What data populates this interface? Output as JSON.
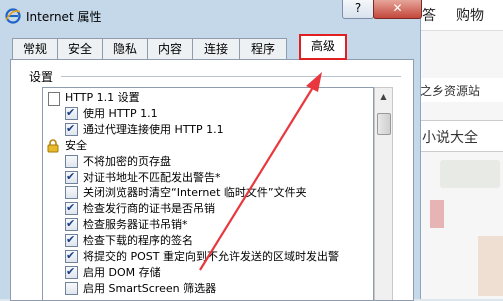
{
  "window": {
    "title": "Internet 属性",
    "help_label": "?",
    "close_label": "✕"
  },
  "tabs": [
    {
      "label": "常规"
    },
    {
      "label": "安全"
    },
    {
      "label": "隐私"
    },
    {
      "label": "内容"
    },
    {
      "label": "连接"
    },
    {
      "label": "程序"
    },
    {
      "label": "高级",
      "active": true
    }
  ],
  "settings": {
    "label": "设置",
    "items": [
      {
        "type": "group",
        "icon": "document-icon",
        "label": "HTTP 1.1 设置"
      },
      {
        "type": "checkbox",
        "checked": true,
        "label": "使用 HTTP 1.1"
      },
      {
        "type": "checkbox",
        "checked": true,
        "label": "通过代理连接使用 HTTP 1.1"
      },
      {
        "type": "group",
        "icon": "lock-icon",
        "label": "安全"
      },
      {
        "type": "checkbox",
        "checked": false,
        "label": "不将加密的页存盘"
      },
      {
        "type": "checkbox",
        "checked": true,
        "label": "对证书地址不匹配发出警告*"
      },
      {
        "type": "checkbox",
        "checked": false,
        "label": "关闭浏览器时清空“Internet 临时文件”文件夹"
      },
      {
        "type": "checkbox",
        "checked": true,
        "label": "检查发行商的证书是否吊销"
      },
      {
        "type": "checkbox",
        "checked": true,
        "label": "检查服务器证书吊销*"
      },
      {
        "type": "checkbox",
        "checked": true,
        "label": "检查下载的程序的签名"
      },
      {
        "type": "checkbox",
        "checked": true,
        "label": "将提交的 POST 重定向到不允许发送的区域时发出警"
      },
      {
        "type": "checkbox",
        "checked": true,
        "label": "启用 DOM 存储"
      },
      {
        "type": "checkbox",
        "checked": false,
        "label": "启用 SmartScreen 筛选器"
      }
    ]
  },
  "background_page": {
    "menu": [
      "答",
      "购物"
    ],
    "site_link": "之乡资源站",
    "novel_label": "小说大全"
  },
  "colors": {
    "highlight": "#e02020",
    "arrow": "#e8383d"
  }
}
